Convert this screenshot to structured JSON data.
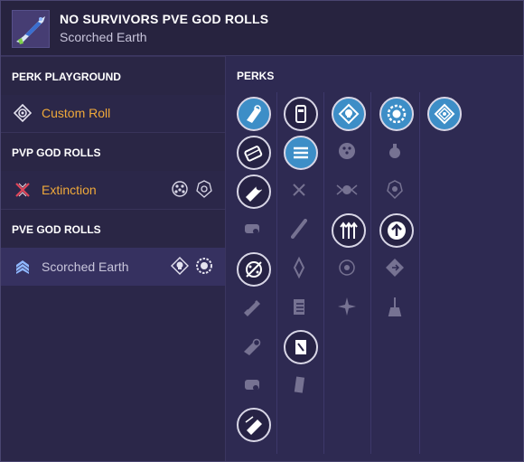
{
  "header": {
    "title": "NO SURVIVORS PVE GOD ROLLS",
    "subtitle": "Scorched Earth"
  },
  "sidebar": {
    "sections": [
      {
        "heading": "PERK PLAYGROUND",
        "rolls": [
          {
            "label": "Custom Roll",
            "icon": "target-dot-icon"
          }
        ]
      },
      {
        "heading": "PVP GOD ROLLS",
        "rolls": [
          {
            "label": "Extinction",
            "icon": "crossed-red-x-icon"
          }
        ]
      },
      {
        "heading": "PVE GOD ROLLS",
        "rolls": [
          {
            "label": "Scorched Earth",
            "icon": "chevron-rank-icon"
          }
        ]
      }
    ]
  },
  "perks": {
    "title": "PERKS"
  },
  "colors": {
    "accent_orange": "#f0a93a",
    "active_perk_blue": "#3d8ec7",
    "panel": "#2e2a52"
  }
}
